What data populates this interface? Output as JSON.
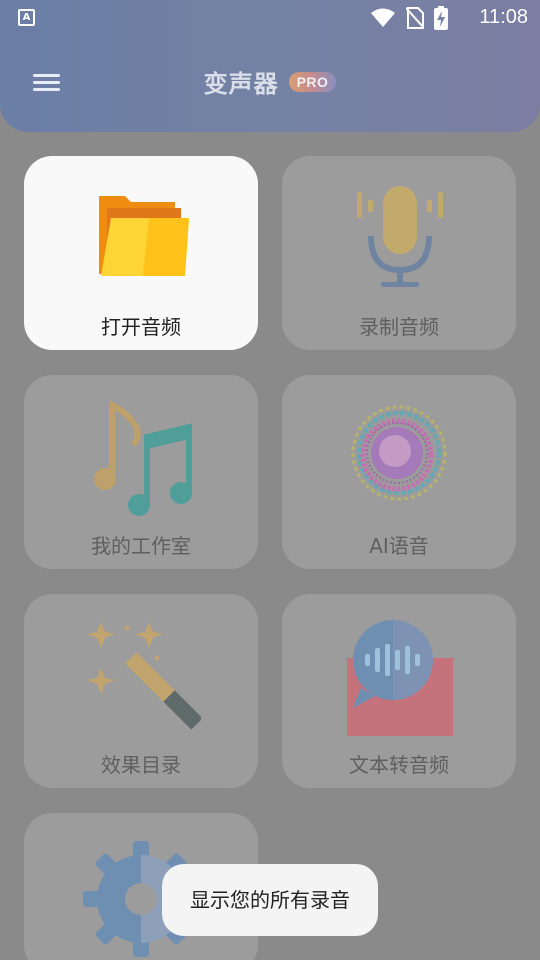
{
  "status_bar": {
    "notification_icon": "a-icon",
    "time": "11:08",
    "icons": [
      "wifi-icon",
      "no-sim-icon",
      "battery-charging-icon"
    ]
  },
  "header": {
    "menu_icon": "menu-icon",
    "title": "变声器",
    "badge": "PRO"
  },
  "tiles": [
    {
      "label": "打开音频",
      "icon": "folder-icon"
    },
    {
      "label": "录制音频",
      "icon": "microphone-icon"
    },
    {
      "label": "我的工作室",
      "icon": "music-notes-icon"
    },
    {
      "label": "AI语音",
      "icon": "ai-voice-icon"
    },
    {
      "label": "效果目录",
      "icon": "magic-wand-icon"
    },
    {
      "label": "文本转音频",
      "icon": "text-to-speech-icon"
    },
    {
      "label": "",
      "icon": "settings-gear-icon"
    }
  ],
  "toast": "显示您的所有录音",
  "colors": {
    "header_gradient": "#7482a4",
    "overlay": "#8a8a8a",
    "active_card": "#f9f9f9"
  }
}
